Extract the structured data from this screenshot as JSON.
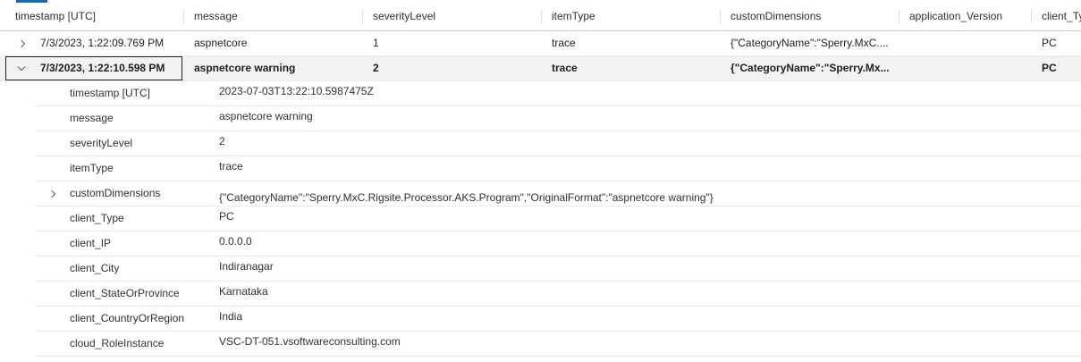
{
  "columns": [
    "timestamp [UTC]",
    "message",
    "severityLevel",
    "itemType",
    "customDimensions",
    "application_Version",
    "client_Ty"
  ],
  "rows": [
    {
      "timestamp": "7/3/2023, 1:22:09.769 PM",
      "message": "aspnetcore",
      "severityLevel": "1",
      "itemType": "trace",
      "customDimensions": "{\"CategoryName\":\"Sperry.MxC....",
      "application_Version": "",
      "client_Type": "PC"
    },
    {
      "timestamp": "7/3/2023, 1:22:10.598 PM",
      "message": "aspnetcore warning",
      "severityLevel": "2",
      "itemType": "trace",
      "customDimensions": "{\"CategoryName\":\"Sperry.Mx...",
      "application_Version": "",
      "client_Type": "PC"
    }
  ],
  "details": [
    {
      "key": "timestamp [UTC]",
      "value": "2023-07-03T13:22:10.5987475Z"
    },
    {
      "key": "message",
      "value": "aspnetcore warning"
    },
    {
      "key": "severityLevel",
      "value": "2"
    },
    {
      "key": "itemType",
      "value": "trace"
    },
    {
      "key": "customDimensions",
      "value": "{\"CategoryName\":\"Sperry.MxC.Rigsite.Processor.AKS.Program\",\"OriginalFormat\":\"aspnetcore warning\"}"
    },
    {
      "key": "client_Type",
      "value": "PC"
    },
    {
      "key": "client_IP",
      "value": "0.0.0.0"
    },
    {
      "key": "client_City",
      "value": "Indiranagar"
    },
    {
      "key": "client_StateOrProvince",
      "value": "Karnataka"
    },
    {
      "key": "client_CountryOrRegion",
      "value": "India"
    },
    {
      "key": "cloud_RoleInstance",
      "value": "VSC-DT-051.vsoftwareconsulting.com"
    }
  ],
  "icons": {
    "collapsed": "chevron-right-icon",
    "expanded": "chevron-down-icon"
  }
}
